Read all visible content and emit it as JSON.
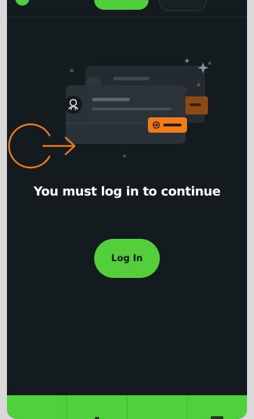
{
  "main": {
    "headline": "You must log in to continue",
    "login_label": "Log In"
  },
  "colors": {
    "background": "#141b1f",
    "accent_green": "#52cf3b",
    "accent_orange": "#f07b17"
  },
  "icons": {
    "login": "login-arrow-icon",
    "avatar": "user-avatar-icon",
    "sparkle": "sparkle-icon"
  },
  "bottom_nav": {
    "items": [
      "nav-home",
      "nav-explore",
      "nav-activity",
      "nav-profile"
    ]
  }
}
